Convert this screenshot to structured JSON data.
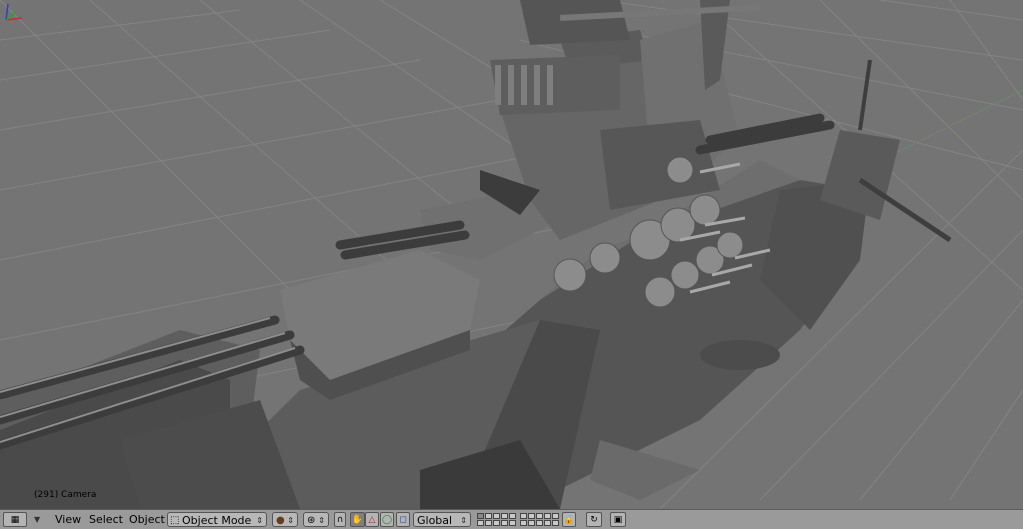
{
  "viewport": {
    "status_text": "(291) Camera",
    "background": "#747474",
    "grid_color": "#8a8a8a"
  },
  "header": {
    "window_type_icon": "view3d-grid-icon",
    "menus": [
      "View",
      "Select",
      "Object"
    ],
    "mode": {
      "label": "Object Mode",
      "icon": "object-mode-icon"
    },
    "draw_type_icon": "solid-sphere-icon",
    "pivot_icon": "pivot-icon",
    "manipulator_icons": [
      "hand-icon",
      "translate-icon",
      "rotate-icon",
      "scale-icon"
    ],
    "orientation": "Global",
    "lock_icon": "lock-icon",
    "render_icons": [
      "ogl-render-icon",
      "render-icon"
    ]
  }
}
